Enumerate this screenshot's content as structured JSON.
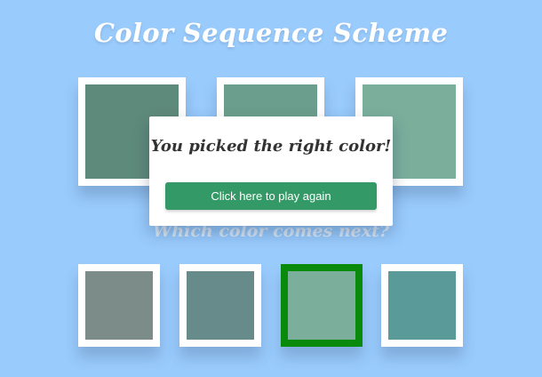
{
  "title": "Color Sequence Scheme",
  "question": "Which color comes next?",
  "sequence": [
    "#5e8a7b",
    "#6c9e8d",
    "#7baf9c"
  ],
  "options": [
    {
      "color": "#7c8c88",
      "selected": false
    },
    {
      "color": "#678b8a",
      "selected": false
    },
    {
      "color": "#7baf9c",
      "selected": true,
      "border_color": "#0a8a0a"
    },
    {
      "color": "#5a9a98",
      "selected": false
    }
  ],
  "modal": {
    "message": "You picked the right color!",
    "button_label": "Click here to play again",
    "button_color": "#339966"
  }
}
